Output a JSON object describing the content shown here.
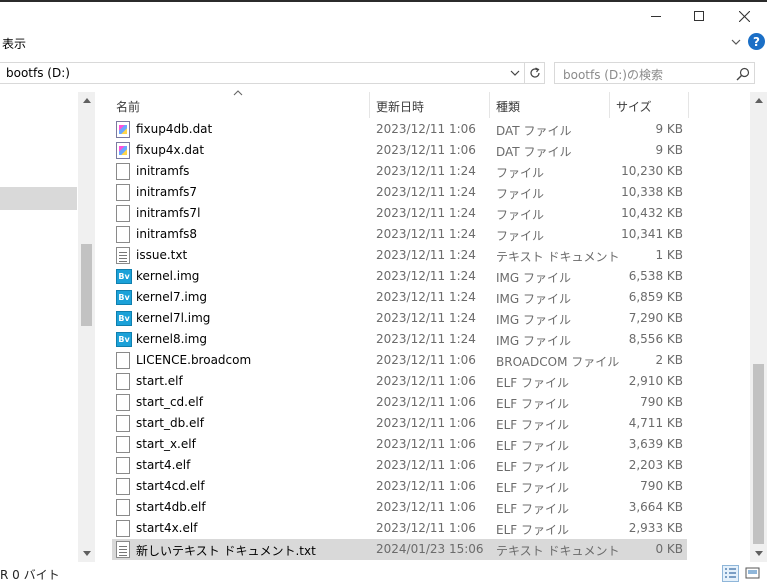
{
  "ribbon": {
    "tab_view": "表示"
  },
  "address": {
    "path": "bootfs (D:)"
  },
  "search": {
    "placeholder": "bootfs (D:)の検索"
  },
  "columns": {
    "name": "名前",
    "modified": "更新日時",
    "type": "種類",
    "size": "サイズ"
  },
  "files": [
    {
      "name": "fixup4db.dat",
      "date": "2023/12/11 1:06",
      "type": "DAT ファイル",
      "size": "9 KB",
      "icon": "dat-file-icon"
    },
    {
      "name": "fixup4x.dat",
      "date": "2023/12/11 1:06",
      "type": "DAT ファイル",
      "size": "9 KB",
      "icon": "dat-file-icon"
    },
    {
      "name": "initramfs",
      "date": "2023/12/11 1:24",
      "type": "ファイル",
      "size": "10,230 KB",
      "icon": "file-icon"
    },
    {
      "name": "initramfs7",
      "date": "2023/12/11 1:24",
      "type": "ファイル",
      "size": "10,338 KB",
      "icon": "file-icon"
    },
    {
      "name": "initramfs7l",
      "date": "2023/12/11 1:24",
      "type": "ファイル",
      "size": "10,432 KB",
      "icon": "file-icon"
    },
    {
      "name": "initramfs8",
      "date": "2023/12/11 1:24",
      "type": "ファイル",
      "size": "10,341 KB",
      "icon": "file-icon"
    },
    {
      "name": "issue.txt",
      "date": "2023/12/11 1:24",
      "type": "テキスト ドキュメント",
      "size": "1 KB",
      "icon": "text-file-icon"
    },
    {
      "name": "kernel.img",
      "date": "2023/12/11 1:24",
      "type": "IMG ファイル",
      "size": "6,538 KB",
      "icon": "img-file-icon"
    },
    {
      "name": "kernel7.img",
      "date": "2023/12/11 1:24",
      "type": "IMG ファイル",
      "size": "6,859 KB",
      "icon": "img-file-icon"
    },
    {
      "name": "kernel7l.img",
      "date": "2023/12/11 1:24",
      "type": "IMG ファイル",
      "size": "7,290 KB",
      "icon": "img-file-icon"
    },
    {
      "name": "kernel8.img",
      "date": "2023/12/11 1:24",
      "type": "IMG ファイル",
      "size": "8,556 KB",
      "icon": "img-file-icon"
    },
    {
      "name": "LICENCE.broadcom",
      "date": "2023/12/11 1:06",
      "type": "BROADCOM ファイル",
      "size": "2 KB",
      "icon": "file-icon"
    },
    {
      "name": "start.elf",
      "date": "2023/12/11 1:06",
      "type": "ELF ファイル",
      "size": "2,910 KB",
      "icon": "file-icon"
    },
    {
      "name": "start_cd.elf",
      "date": "2023/12/11 1:06",
      "type": "ELF ファイル",
      "size": "790 KB",
      "icon": "file-icon"
    },
    {
      "name": "start_db.elf",
      "date": "2023/12/11 1:06",
      "type": "ELF ファイル",
      "size": "4,711 KB",
      "icon": "file-icon"
    },
    {
      "name": "start_x.elf",
      "date": "2023/12/11 1:06",
      "type": "ELF ファイル",
      "size": "3,639 KB",
      "icon": "file-icon"
    },
    {
      "name": "start4.elf",
      "date": "2023/12/11 1:06",
      "type": "ELF ファイル",
      "size": "2,203 KB",
      "icon": "file-icon"
    },
    {
      "name": "start4cd.elf",
      "date": "2023/12/11 1:06",
      "type": "ELF ファイル",
      "size": "790 KB",
      "icon": "file-icon"
    },
    {
      "name": "start4db.elf",
      "date": "2023/12/11 1:06",
      "type": "ELF ファイル",
      "size": "3,664 KB",
      "icon": "file-icon"
    },
    {
      "name": "start4x.elf",
      "date": "2023/12/11 1:06",
      "type": "ELF ファイル",
      "size": "2,933 KB",
      "icon": "file-icon"
    },
    {
      "name": "新しいテキスト ドキュメント.txt",
      "date": "2024/01/23 15:06",
      "type": "テキスト ドキュメント",
      "size": "0 KB",
      "icon": "text-file-icon",
      "selected": true
    }
  ],
  "status": {
    "text": "R 0 バイト"
  },
  "colors": {
    "help_blue": "#1b6fc6",
    "selection": "#d9d9d9",
    "img_icon": "#1ba1d8"
  }
}
